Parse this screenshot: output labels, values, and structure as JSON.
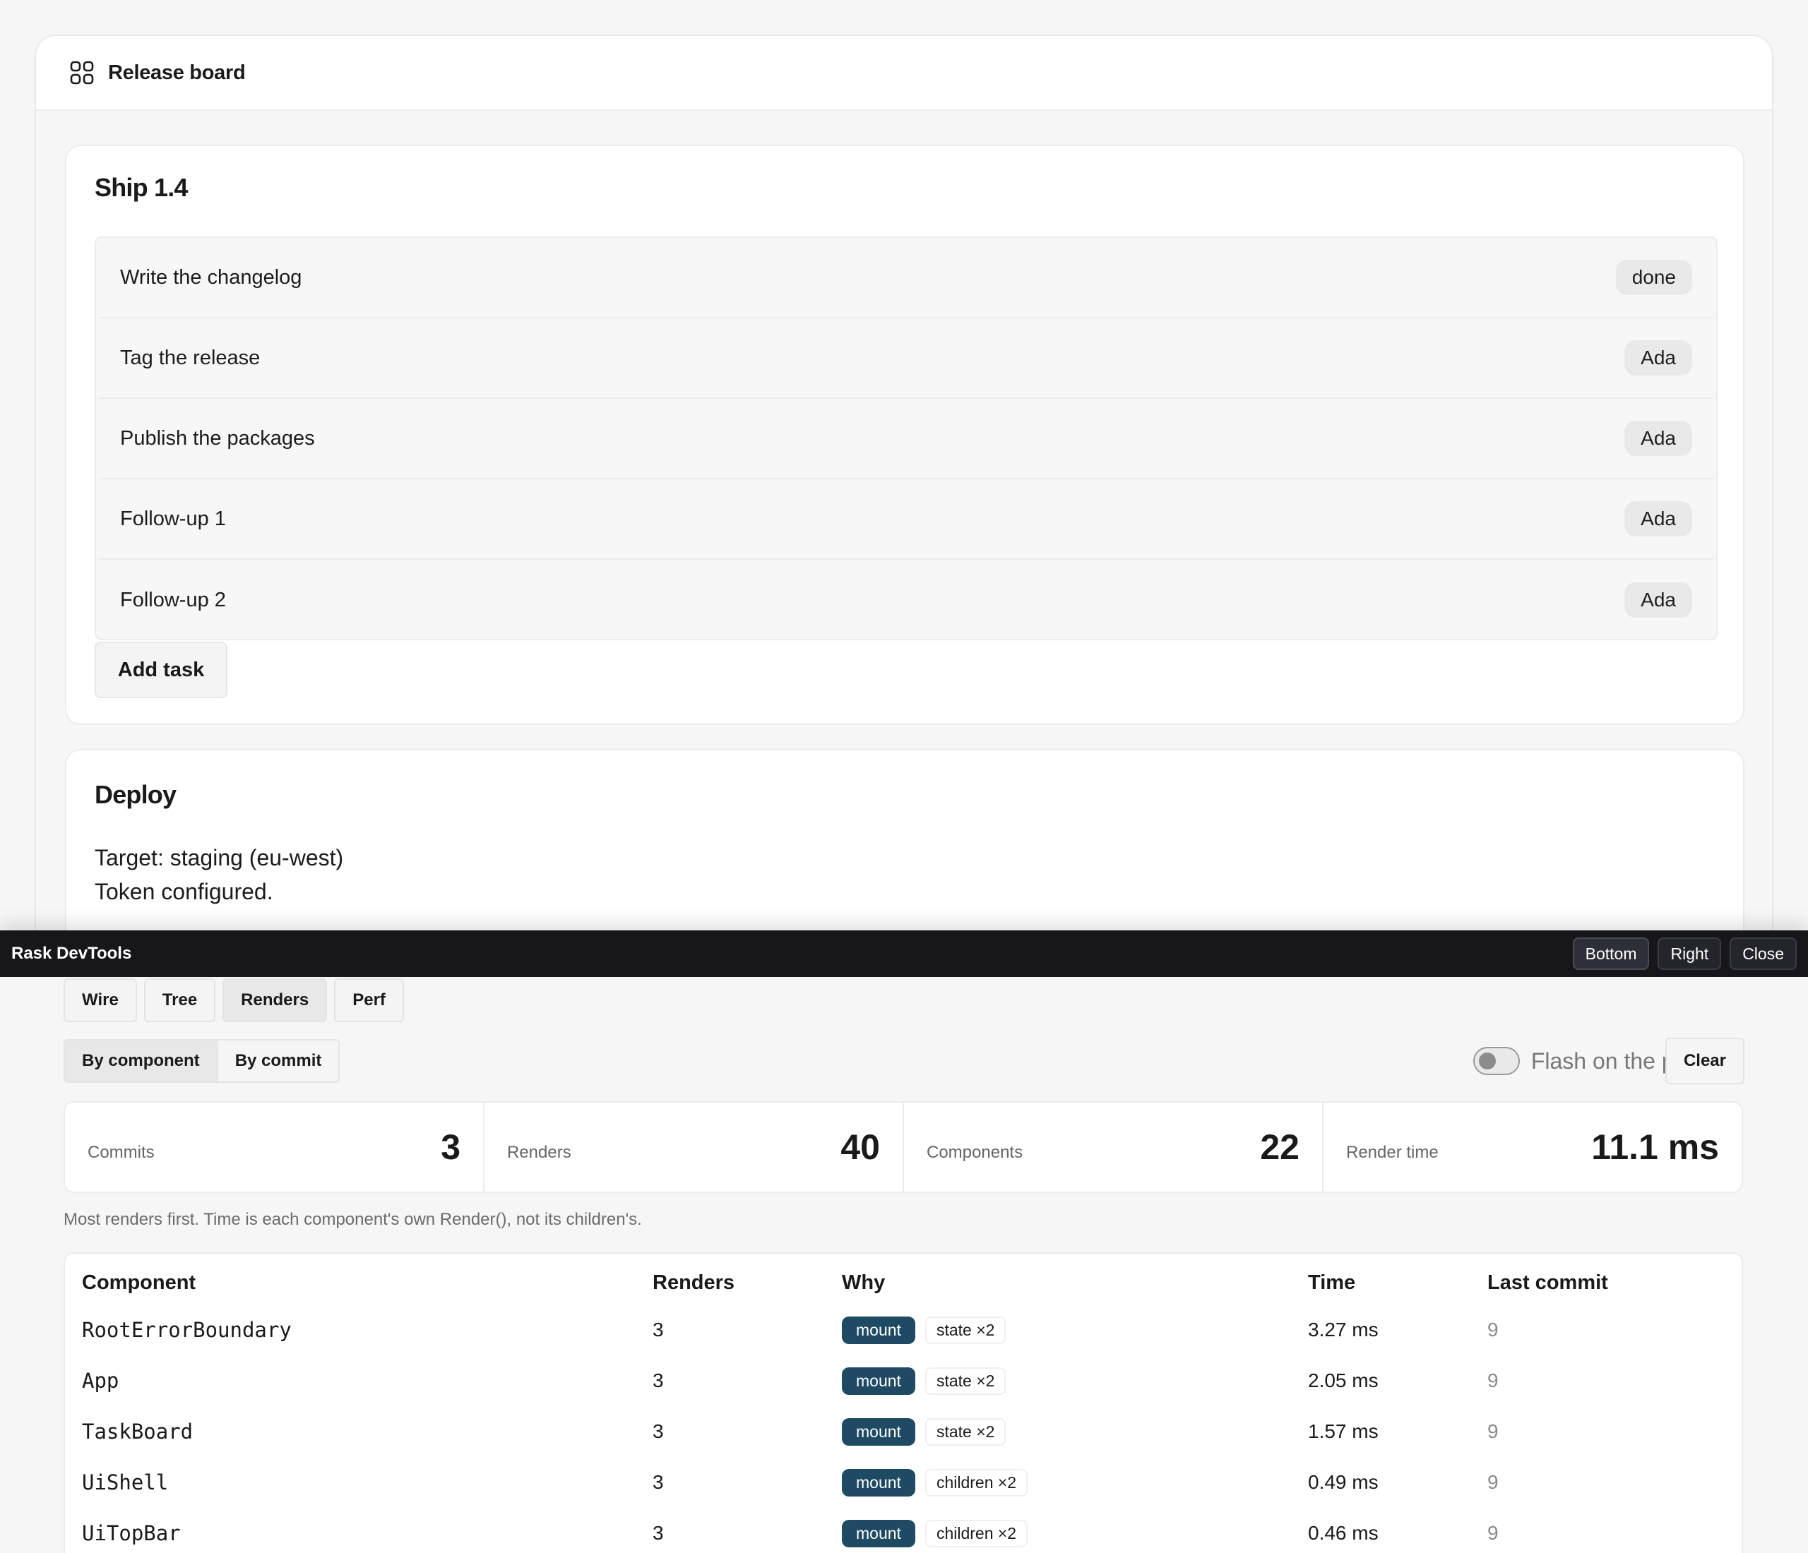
{
  "app": {
    "title": "Release board",
    "icon": "grid-icon"
  },
  "ship_card": {
    "title": "Ship 1.4",
    "tasks": [
      {
        "label": "Write the changelog",
        "badge": "done"
      },
      {
        "label": "Tag the release",
        "badge": "Ada"
      },
      {
        "label": "Publish the packages",
        "badge": "Ada"
      },
      {
        "label": "Follow-up 1",
        "badge": "Ada"
      },
      {
        "label": "Follow-up 2",
        "badge": "Ada"
      }
    ],
    "add_button": "Add task"
  },
  "deploy_card": {
    "title": "Deploy",
    "target": "Target: staging (eu-west)",
    "token": "Token configured."
  },
  "devtools": {
    "title": "Rask DevTools",
    "dock_bottom": "Bottom",
    "dock_right": "Right",
    "close": "Close",
    "tabs": [
      "Wire",
      "Tree",
      "Renders",
      "Perf"
    ],
    "active_tab": "Renders",
    "view_modes": [
      "By component",
      "By commit"
    ],
    "active_view": "By component",
    "flash_label": "Flash on the page",
    "flash_enabled": false,
    "clear": "Clear",
    "stats": [
      {
        "label": "Commits",
        "value": "3"
      },
      {
        "label": "Renders",
        "value": "40"
      },
      {
        "label": "Components",
        "value": "22"
      },
      {
        "label": "Render time",
        "value": "11.1 ms"
      }
    ],
    "note": "Most renders first. Time is each component's own Render(), not its children's.",
    "table": {
      "headers": [
        "Component",
        "Renders",
        "Why",
        "Time",
        "Last commit"
      ],
      "rows": [
        {
          "component": "RootErrorBoundary",
          "renders": "3",
          "why": [
            "mount",
            "state ×2"
          ],
          "time": "3.27 ms",
          "last_commit": "9"
        },
        {
          "component": "App",
          "renders": "3",
          "why": [
            "mount",
            "state ×2"
          ],
          "time": "2.05 ms",
          "last_commit": "9"
        },
        {
          "component": "TaskBoard",
          "renders": "3",
          "why": [
            "mount",
            "state ×2"
          ],
          "time": "1.57 ms",
          "last_commit": "9"
        },
        {
          "component": "UiShell",
          "renders": "3",
          "why": [
            "mount",
            "children ×2"
          ],
          "time": "0.49 ms",
          "last_commit": "9"
        },
        {
          "component": "UiTopBar",
          "renders": "3",
          "why": [
            "mount",
            "children ×2"
          ],
          "time": "0.46 ms",
          "last_commit": "9"
        }
      ]
    },
    "colors": {
      "bar_bg": "#16161b",
      "mount_pill": "#1f4a63"
    }
  }
}
